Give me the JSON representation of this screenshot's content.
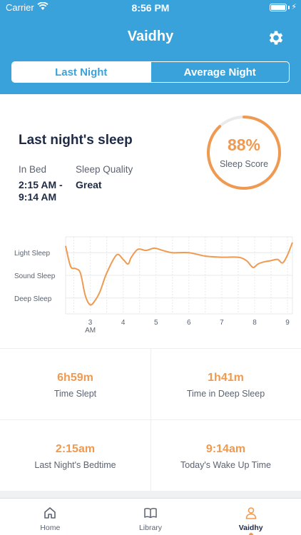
{
  "status_bar": {
    "carrier": "Carrier",
    "time": "8:56 PM"
  },
  "header": {
    "title": "Vaidhy"
  },
  "tabs": [
    {
      "label": "Last Night",
      "active": true
    },
    {
      "label": "Average Night",
      "active": false
    }
  ],
  "summary": {
    "heading": "Last night's sleep",
    "in_bed_label": "In Bed",
    "in_bed_line1": "2:15 AM -",
    "in_bed_line2": "9:14 AM",
    "quality_label": "Sleep Quality",
    "quality_value": "Great"
  },
  "score": {
    "percent_text": "88%",
    "percent": 88,
    "label": "Sleep Score"
  },
  "chart_data": {
    "type": "line",
    "y_categories": [
      "Light Sleep",
      "Sound Sleep",
      "Deep Sleep"
    ],
    "x_tick_labels": [
      "3\nAM",
      "4",
      "5",
      "6",
      "7",
      "8",
      "9"
    ],
    "x_ticks": [
      3,
      4,
      5,
      6,
      7,
      8,
      9
    ],
    "xlim": [
      2.25,
      9.15
    ],
    "ylim": [
      -0.2,
      3.2
    ],
    "grid": true,
    "points": [
      [
        2.25,
        2.8
      ],
      [
        2.4,
        1.9
      ],
      [
        2.55,
        1.8
      ],
      [
        2.7,
        1.6
      ],
      [
        2.85,
        0.6
      ],
      [
        3.0,
        0.2
      ],
      [
        3.15,
        0.4
      ],
      [
        3.3,
        0.8
      ],
      [
        3.5,
        1.6
      ],
      [
        3.8,
        2.4
      ],
      [
        4.0,
        2.2
      ],
      [
        4.15,
        2.0
      ],
      [
        4.25,
        2.3
      ],
      [
        4.45,
        2.65
      ],
      [
        4.7,
        2.6
      ],
      [
        4.95,
        2.7
      ],
      [
        5.2,
        2.6
      ],
      [
        5.5,
        2.5
      ],
      [
        6.0,
        2.5
      ],
      [
        6.5,
        2.35
      ],
      [
        7.0,
        2.3
      ],
      [
        7.5,
        2.3
      ],
      [
        7.75,
        2.15
      ],
      [
        7.95,
        1.85
      ],
      [
        8.1,
        2.0
      ],
      [
        8.3,
        2.1
      ],
      [
        8.5,
        2.15
      ],
      [
        8.7,
        2.2
      ],
      [
        8.85,
        2.05
      ],
      [
        9.0,
        2.4
      ],
      [
        9.15,
        2.95
      ]
    ]
  },
  "stats": [
    {
      "value": "6h59m",
      "label": "Time Slept"
    },
    {
      "value": "1h41m",
      "label": "Time in Deep Sleep"
    },
    {
      "value": "2:15am",
      "label": "Last Night's Bedtime"
    },
    {
      "value": "9:14am",
      "label": "Today's Wake Up Time"
    }
  ],
  "tab_bar": [
    {
      "label": "Home",
      "icon": "home-icon",
      "active": false
    },
    {
      "label": "Library",
      "icon": "book-icon",
      "active": false
    },
    {
      "label": "Vaidhy",
      "icon": "person-icon",
      "active": true
    }
  ],
  "colors": {
    "header": "#3aa2db",
    "accent": "#ef9a50",
    "text_dark": "#1f2a44",
    "text_muted": "#5b6372"
  }
}
